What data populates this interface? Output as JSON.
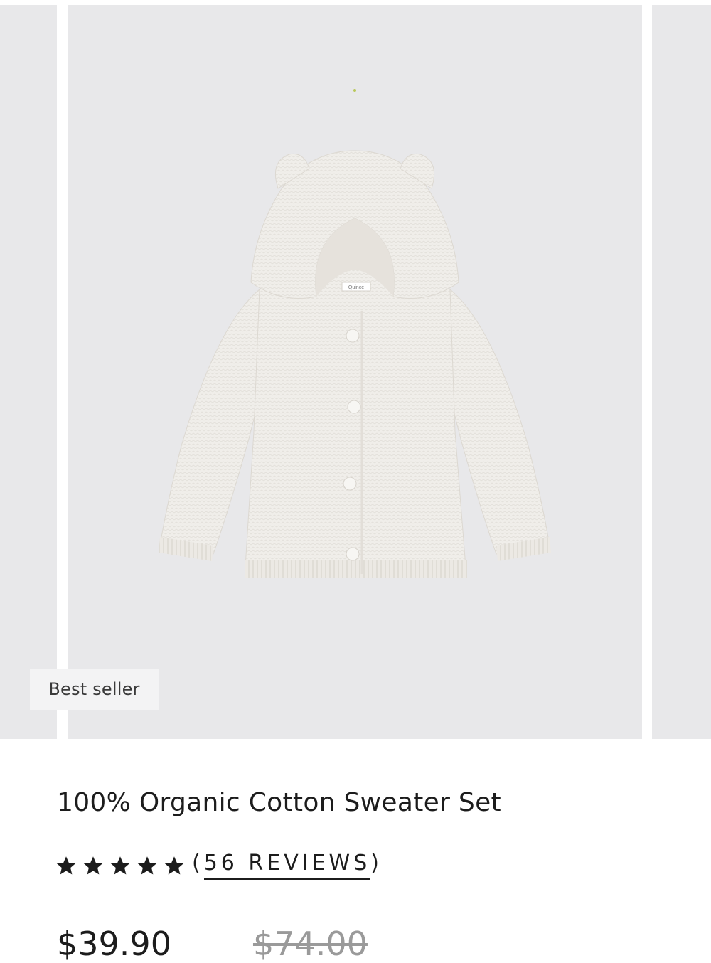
{
  "product": {
    "badge": "Best seller",
    "title": "100% Organic Cotton Sweater Set",
    "rating": {
      "stars": 5,
      "reviews_open": "(",
      "reviews_label": "56 REVIEWS",
      "reviews_close": ")"
    },
    "price": {
      "sale": "$39.90",
      "original": "$74.00"
    },
    "image_label": "Quince"
  },
  "colors": {
    "panel_bg": "#e8e8ea",
    "sweater": "#f0eeea",
    "text": "#1c1c1c",
    "muted": "#9a9a9a"
  }
}
